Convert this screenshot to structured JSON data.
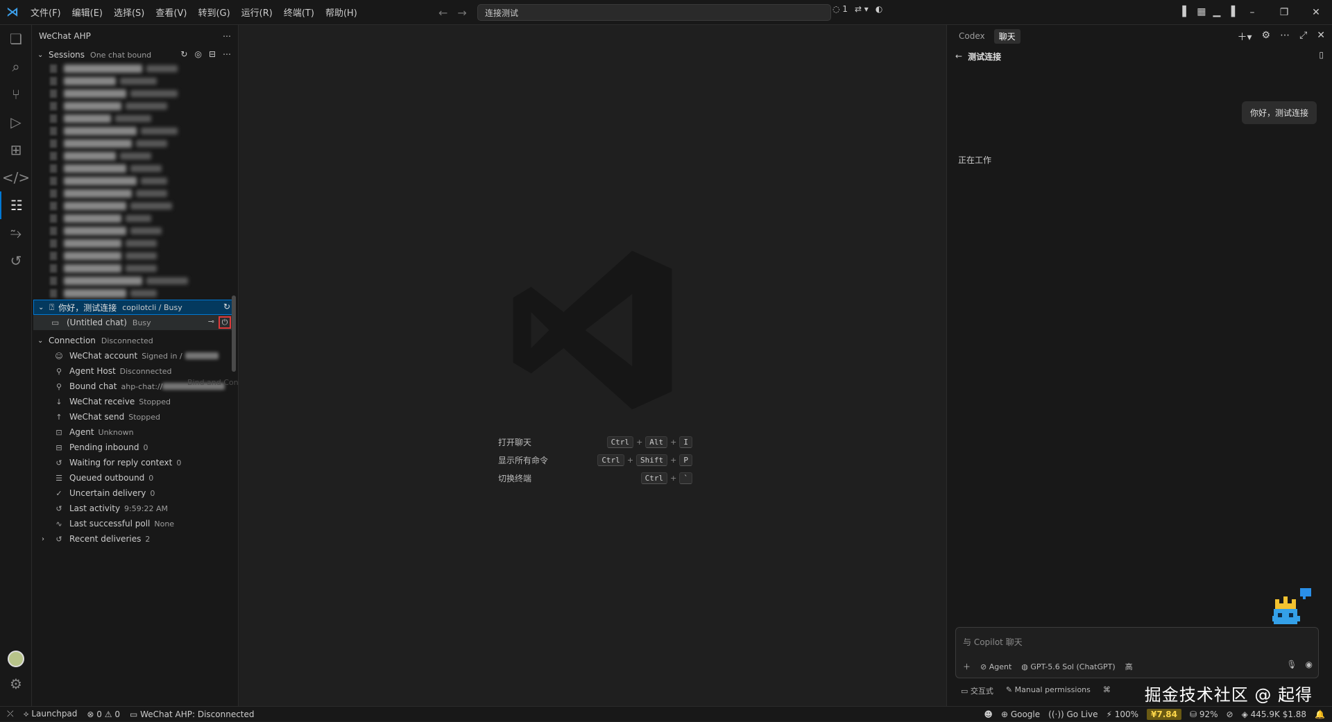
{
  "titlebar": {
    "menu": [
      "文件(F)",
      "编辑(E)",
      "选择(S)",
      "查看(V)",
      "转到(G)",
      "运行(R)",
      "终端(T)",
      "帮助(H)"
    ],
    "command_center": "连接测试",
    "session_count": "1"
  },
  "sidebar": {
    "title": "WeChat AHP",
    "sessions_label": "Sessions",
    "sessions_sub": "One chat bound",
    "active_session": {
      "title": "你好，测试连接",
      "sub": "copilotcli / Busy"
    },
    "child_chat": {
      "title": "(Untitled chat)",
      "sub": "Busy"
    },
    "tooltip": "Bind and Connect",
    "connection_label": "Connection",
    "connection_sub": "Disconnected",
    "connection_rows": [
      {
        "label": "WeChat account",
        "value": "Signed in /",
        "icon": "account-icon"
      },
      {
        "label": "Agent Host",
        "value": "Disconnected",
        "icon": "plug-icon"
      },
      {
        "label": "Bound chat",
        "value": "ahp-chat://",
        "icon": "pin-icon"
      },
      {
        "label": "WeChat receive",
        "value": "Stopped",
        "icon": "arrow-down-icon"
      },
      {
        "label": "WeChat send",
        "value": "Stopped",
        "icon": "arrow-up-icon"
      },
      {
        "label": "Agent",
        "value": "Unknown",
        "icon": "agent-icon"
      },
      {
        "label": "Pending inbound",
        "value": "0",
        "icon": "inbox-icon"
      },
      {
        "label": "Waiting for reply context",
        "value": "0",
        "icon": "history-icon"
      },
      {
        "label": "Queued outbound",
        "value": "0",
        "icon": "list-icon"
      },
      {
        "label": "Uncertain delivery",
        "value": "0",
        "icon": "check-icon"
      },
      {
        "label": "Last activity",
        "value": "9:59:22 AM",
        "icon": "history-icon"
      },
      {
        "label": "Last successful poll",
        "value": "None",
        "icon": "pulse-icon"
      },
      {
        "label": "Recent deliveries",
        "value": "2",
        "icon": "history-icon"
      }
    ]
  },
  "editor": {
    "shortcuts": [
      {
        "label": "打开聊天",
        "keys": [
          "Ctrl",
          "Alt",
          "I"
        ]
      },
      {
        "label": "显示所有命令",
        "keys": [
          "Ctrl",
          "Shift",
          "P"
        ]
      },
      {
        "label": "切换终端",
        "keys": [
          "Ctrl",
          "`"
        ]
      }
    ]
  },
  "chat": {
    "tabs": [
      "Codex",
      "聊天"
    ],
    "header": "测试连接",
    "user_message": "你好，测试连接",
    "status": "正在工作",
    "input_placeholder": "与 Copilot 聊天",
    "agent_label": "Agent",
    "model_label": "GPT-5.6 Sol (ChatGPT)",
    "effort_label": "高",
    "footer_mode": "交互式",
    "footer_permissions": "Manual permissions",
    "watermark_credit": "掘金技术社区 @ 起得"
  },
  "statusbar": {
    "launchpad": "Launchpad",
    "errors": "0",
    "warnings": "0",
    "wechat": "WeChat AHP: Disconnected",
    "google": "Google",
    "golive": "Go Live",
    "signal": "100%",
    "price": "¥7.84",
    "percent": "92%",
    "tokens": "445.9K $1.88"
  },
  "colors": {
    "accent": "#0078d4",
    "highlight_border": "#e03a3a",
    "price_badge": "#ffd84a"
  }
}
